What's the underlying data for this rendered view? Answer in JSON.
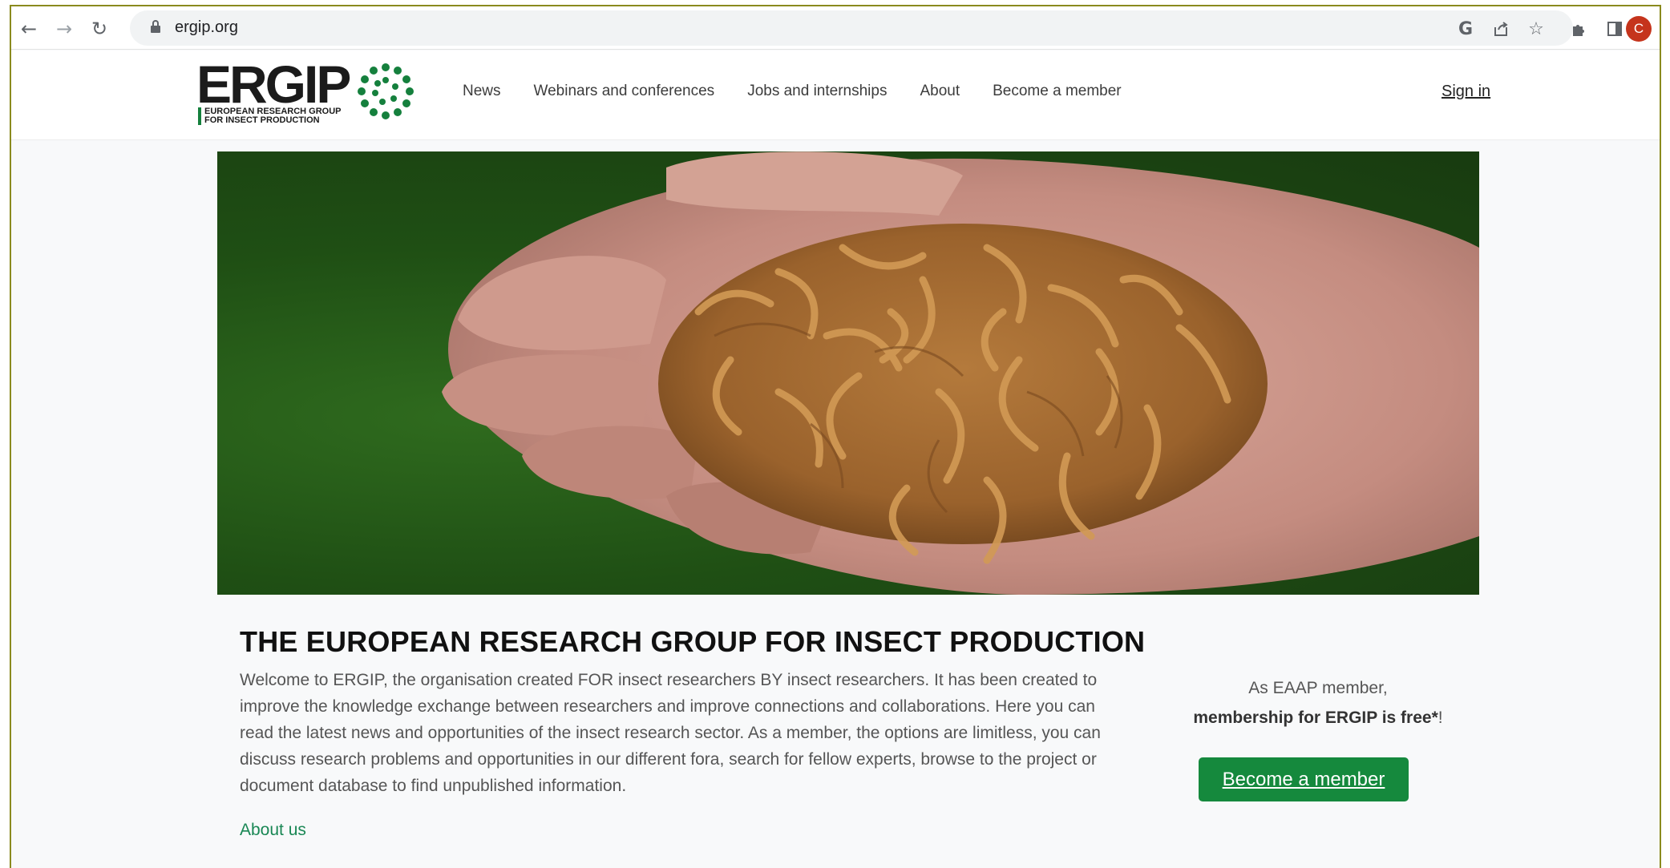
{
  "browser": {
    "url": "ergip.org",
    "profile_initial": "C",
    "icons": [
      "back-arrow-icon",
      "forward-arrow-icon",
      "reload-icon",
      "lock-icon",
      "google-icon",
      "share-icon",
      "star-icon",
      "extensions-icon",
      "side-panel-icon"
    ]
  },
  "header": {
    "logo_word": "ERGIP",
    "logo_subtitle_line1": "EUROPEAN RESEARCH GROUP",
    "logo_subtitle_line2": "FOR INSECT PRODUCTION",
    "nav": [
      "News",
      "Webinars and conferences",
      "Jobs and internships",
      "About",
      "Become a member"
    ],
    "sign_in": "Sign in"
  },
  "main": {
    "title": "THE EUROPEAN RESEARCH GROUP FOR INSECT PRODUCTION",
    "intro": "Welcome to ERGIP, the organisation created FOR insect researchers BY insect researchers. It has been created to improve the knowledge exchange between researchers and improve connections and collaborations. Here you can read the latest news and opportunities of the insect research sector. As a member, the options are limitless, you can discuss research problems and opportunities in our different fora, search for fellow experts, browse to the project or document database to find unpublished information.",
    "about_link": "About us"
  },
  "side": {
    "line1": "As EAAP member,",
    "line2_bold": "membership for ERGIP is free*",
    "line2_tail": "!",
    "cta": "Become a member"
  },
  "colors": {
    "accent_green": "#15893d",
    "link_green": "#198754",
    "frame": "#8a8a1e",
    "avatar": "#c5341c"
  }
}
